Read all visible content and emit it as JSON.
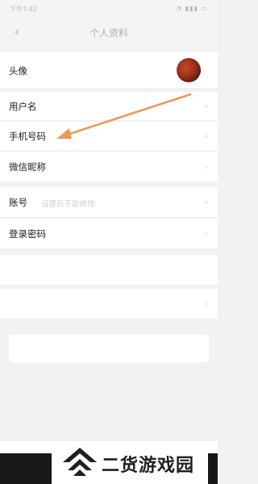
{
  "status_bar": {
    "time": "下午7:42",
    "icons": "◔ ▮▮▮ ▭"
  },
  "nav": {
    "back_icon": "‹",
    "title": "个人资料"
  },
  "rows": {
    "avatar": {
      "label": "头像"
    },
    "username": {
      "label": "用户名",
      "value": ""
    },
    "phone": {
      "label": "手机号码",
      "value": ""
    },
    "wechat": {
      "label": "微信昵称",
      "value": ""
    },
    "account": {
      "label": "账号",
      "hint": "设置后不能修改"
    },
    "password": {
      "label": "登录密码",
      "value": ""
    },
    "last_login": {
      "label": "",
      "value": ""
    },
    "blocked": {
      "label": ""
    }
  },
  "logout_button": "",
  "footer": "",
  "watermark": {
    "text": "二货游戏园"
  },
  "colors": {
    "arrow": "#e79a5a",
    "background": "#f2f2f4",
    "row": "#ffffff"
  }
}
